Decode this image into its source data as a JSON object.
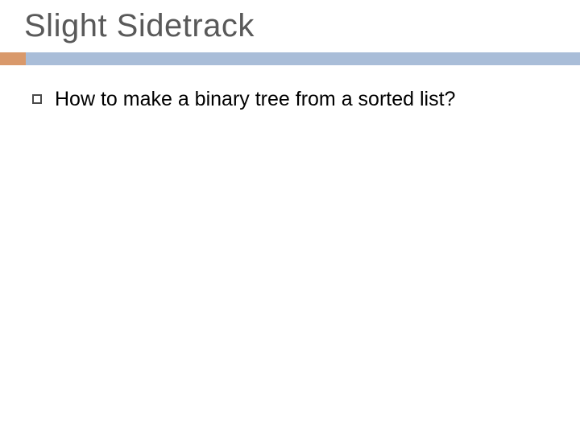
{
  "slide": {
    "title": "Slight Sidetrack",
    "bullets": [
      {
        "text": "How to make a binary tree from a sorted list?"
      }
    ]
  },
  "colors": {
    "title": "#595959",
    "accent": "#d9996b",
    "divider": "#a9bdd8",
    "body": "#000000"
  }
}
